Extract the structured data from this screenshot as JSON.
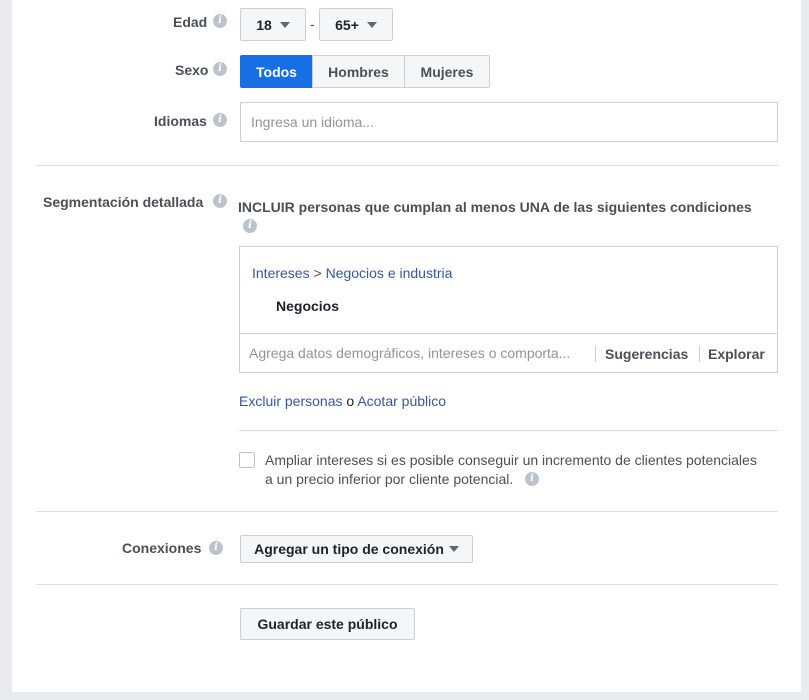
{
  "age": {
    "label": "Edad",
    "min": "18",
    "separator": "-",
    "max": "65+"
  },
  "gender": {
    "label": "Sexo",
    "options": [
      "Todos",
      "Hombres",
      "Mujeres"
    ],
    "selected": "Todos"
  },
  "languages": {
    "label": "Idiomas",
    "placeholder": "Ingresa un idioma..."
  },
  "detailed_targeting": {
    "label": "Segmentación detallada",
    "include_text": "INCLUIR personas que cumplan al menos UNA de las siguientes condiciones",
    "breadcrumb_root": "Intereses",
    "breadcrumb_sep": ">",
    "breadcrumb_child": "Negocios e industria",
    "selected_item": "Negocios",
    "search_placeholder": "Agrega datos demográficos, intereses o comporta...",
    "suggestions_label": "Sugerencias",
    "explore_label": "Explorar",
    "exclude_link": "Excluir personas",
    "or_text": "o",
    "narrow_link": "Acotar público",
    "expand_text_line1": "Ampliar intereses si es posible conseguir un incremento de clientes potenciales",
    "expand_text_line2": "a un precio inferior por cliente potencial."
  },
  "connections": {
    "label": "Conexiones",
    "dropdown_label": "Agregar un tipo de conexión"
  },
  "save_button": "Guardar este público",
  "colors": {
    "accent": "#166fe5",
    "link": "#365899",
    "background": "#e9ebee"
  }
}
